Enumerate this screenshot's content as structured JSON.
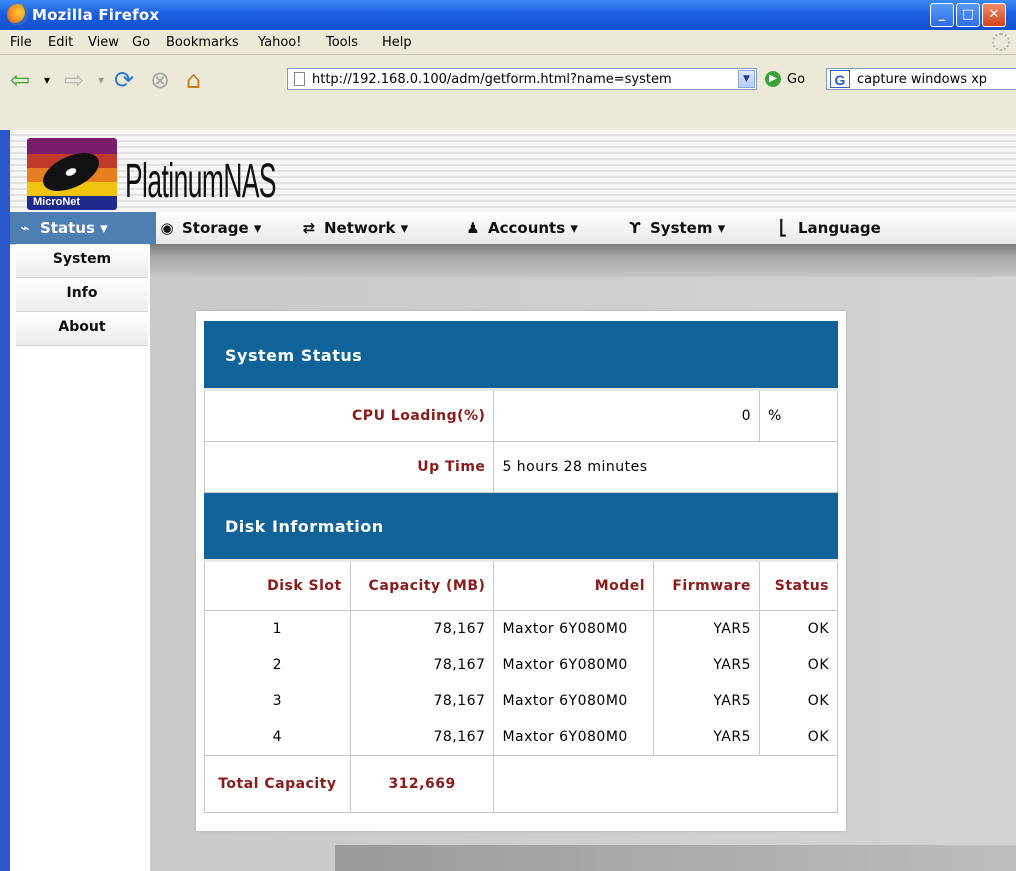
{
  "window": {
    "title": "Mozilla Firefox",
    "controls": [
      "_",
      "□",
      "✕"
    ]
  },
  "menubar": [
    "File",
    "Edit",
    "View",
    "Go",
    "Bookmarks",
    "Yahoo!",
    "Tools",
    "Help"
  ],
  "toolbar": {
    "url": "http://192.168.0.100/adm/getform.html?name=system",
    "go_label": "Go",
    "search_text": "capture windows xp"
  },
  "app": {
    "logo_text": "MicroNet",
    "brand": "PlatinumNAS",
    "nav": [
      {
        "label": "Status ▾",
        "icon": "hdd-icon"
      },
      {
        "label": "Storage ▾",
        "icon": "disc-icon"
      },
      {
        "label": "Network ▾",
        "icon": "network-icon"
      },
      {
        "label": "Accounts ▾",
        "icon": "users-icon"
      },
      {
        "label": "System ▾",
        "icon": "wrench-icon"
      },
      {
        "label": "Language",
        "icon": "language-icon"
      }
    ],
    "status_menu": [
      "System",
      "Info",
      "About"
    ]
  },
  "system_status": {
    "heading": "System Status",
    "cpu_label": "CPU Loading(%)",
    "cpu_value": "0",
    "cpu_unit": "%",
    "uptime_label": "Up Time",
    "uptime_value": "5 hours 28 minutes"
  },
  "disk_info": {
    "heading": "Disk Information",
    "columns": [
      "Disk Slot",
      "Capacity (MB)",
      "Model",
      "Firmware",
      "Status"
    ],
    "rows": [
      [
        "1",
        "78,167",
        "Maxtor 6Y080M0",
        "YAR5",
        "OK"
      ],
      [
        "2",
        "78,167",
        "Maxtor 6Y080M0",
        "YAR5",
        "OK"
      ],
      [
        "3",
        "78,167",
        "Maxtor 6Y080M0",
        "YAR5",
        "OK"
      ],
      [
        "4",
        "78,167",
        "Maxtor 6Y080M0",
        "YAR5",
        "OK"
      ]
    ],
    "total_label": "Total Capacity",
    "total_value": "312,669"
  }
}
